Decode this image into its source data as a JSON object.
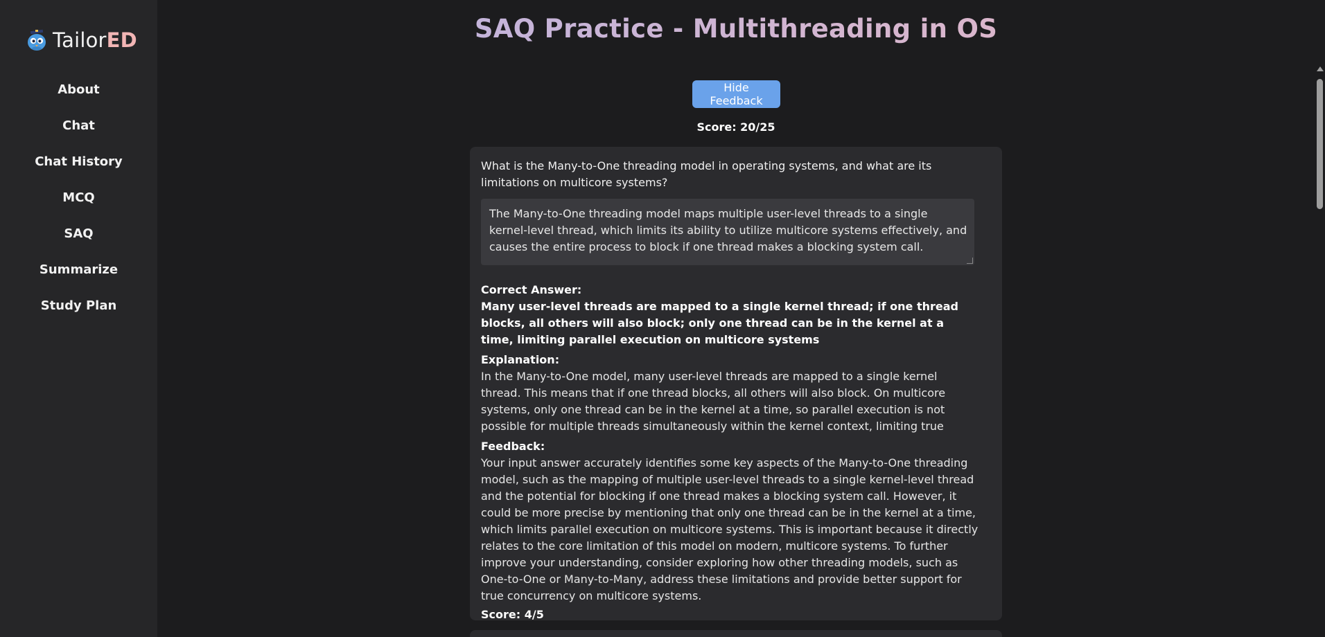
{
  "brand": {
    "name_light": "Tailor",
    "name_bold": "ED",
    "mascot_icon": "owl-mascot-icon"
  },
  "sidebar": {
    "items": [
      {
        "label": "About"
      },
      {
        "label": "Chat"
      },
      {
        "label": "Chat History"
      },
      {
        "label": "MCQ"
      },
      {
        "label": "SAQ"
      },
      {
        "label": "Summarize"
      },
      {
        "label": "Study Plan"
      }
    ]
  },
  "page": {
    "title": "SAQ Practice - Multithreading in OS",
    "hide_feedback_label": "Hide Feedback",
    "total_score": "Score: 20/25"
  },
  "question_card": {
    "question": "What is the Many-to-One threading model in operating systems, and what are its limitations on multicore systems?",
    "user_answer": "The Many-to-One threading model maps multiple user-level threads to a single kernel-level thread, which limits its ability to utilize multicore systems effectively, and causes the entire process to block if one thread makes a blocking system call.",
    "correct_answer_label": "Correct Answer:",
    "correct_answer": "Many user-level threads are mapped to a single kernel thread; if one thread blocks, all others will also block; only one thread can be in the kernel at a time, limiting parallel execution on multicore systems",
    "explanation_label": "Explanation:",
    "explanation": "In the Many-to-One model, many user-level threads are mapped to a single kernel thread. This means that if one thread blocks, all others will also block. On multicore systems, only one thread can be in the kernel at a time, so parallel execution is not possible for multiple threads simultaneously within the kernel context, limiting true concurrency benefits on such systems.",
    "feedback_label": "Feedback:",
    "feedback": "Your input answer accurately identifies some key aspects of the Many-to-One threading model, such as the mapping of multiple user-level threads to a single kernel-level thread and the potential for blocking if one thread makes a blocking system call. However, it could be more precise by mentioning that only one thread can be in the kernel at a time, which limits parallel execution on multicore systems. This is important because it directly relates to the core limitation of this model on modern, multicore systems. To further improve your understanding, consider exploring how other threading models, such as One-to-One or Many-to-Many, address these limitations and provide better support for true concurrency on multicore systems.",
    "score": "Score: 4/5"
  },
  "colors": {
    "background": "#1c1c1e",
    "sidebar": "#262628",
    "card": "#2b2b2e",
    "button": "#6aa2ea",
    "title_gradient_start": "#b6b3e2",
    "title_gradient_end": "#e8b7c4",
    "brand_accent": "#f2b5b5"
  }
}
